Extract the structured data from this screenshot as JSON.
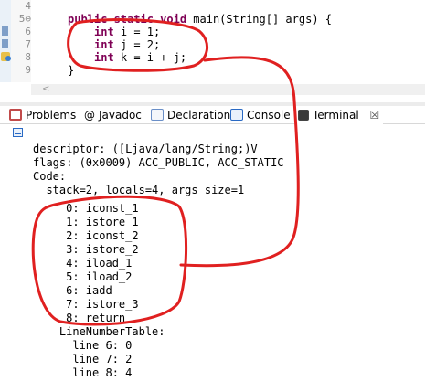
{
  "editor": {
    "lines": [
      {
        "num": "4",
        "text": ""
      },
      {
        "num": "5⊖",
        "kw": "public static void",
        "text": " main(String[] args) {"
      },
      {
        "num": "6",
        "kw": "int",
        "text": " i = 1;"
      },
      {
        "num": "7",
        "kw": "int",
        "text": " j = 2;"
      },
      {
        "num": "8",
        "kw": "int",
        "text": " k = i + j;"
      },
      {
        "num": "9",
        "kw": "",
        "text": "}"
      }
    ],
    "hscroll_arrow": "<"
  },
  "tabs": [
    {
      "label": "Problems",
      "icon": "problems-icon",
      "color": "#c14a4a"
    },
    {
      "label": "Javadoc",
      "icon": "javadoc-icon",
      "color": "#555555"
    },
    {
      "label": "Declaration",
      "icon": "declaration-icon",
      "color": "#6a8fc8"
    },
    {
      "label": "Console",
      "icon": "console-icon",
      "color": "#2a6ac4"
    },
    {
      "label": "Terminal",
      "icon": "terminal-icon",
      "color": "#444444",
      "active": true
    }
  ],
  "tab_close": "☒",
  "console": {
    "lines": [
      "descriptor: ([Ljava/lang/String;)V",
      "flags: (0x0009) ACC_PUBLIC, ACC_STATIC",
      "Code:",
      "  stack=2, locals=4, args_size=1",
      "     0: iconst_1",
      "     1: istore_1",
      "     2: iconst_2",
      "     3: istore_2",
      "     4: iload_1",
      "     5: iload_2",
      "     6: iadd",
      "     7: istore_3",
      "     8: return",
      "    LineNumberTable:",
      "      line 6: 0",
      "      line 7: 2",
      "      line 8: 4"
    ]
  },
  "annotation_color": "#e02020"
}
